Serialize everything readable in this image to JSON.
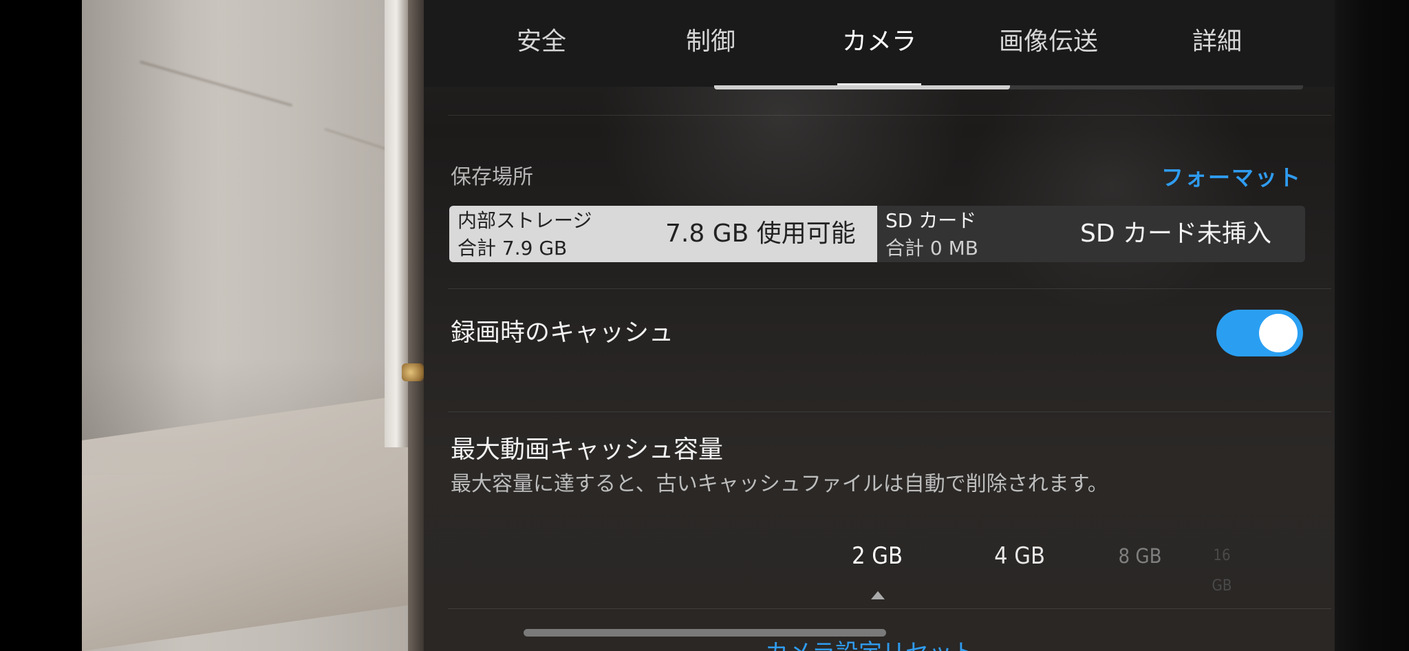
{
  "tabs": [
    {
      "label": "安全",
      "active": false
    },
    {
      "label": "制御",
      "active": false
    },
    {
      "label": "カメラ",
      "active": true
    },
    {
      "label": "画像伝送",
      "active": false
    },
    {
      "label": "詳細",
      "active": false
    }
  ],
  "storage": {
    "section_label": "保存場所",
    "format_label": "フォーマット",
    "internal": {
      "title": "内部ストレージ",
      "total": "合計 7.9 GB",
      "available": "7.8 GB 使用可能"
    },
    "sd": {
      "title": "SD カード",
      "total": "合計 0 MB",
      "status": "SD カード未挿入"
    }
  },
  "recording_cache": {
    "label": "録画時のキャッシュ",
    "enabled": true
  },
  "max_cache": {
    "label": "最大動画キャッシュ容量",
    "description": "最大容量に達すると、古いキャッシュファイルは自動で削除されます。",
    "options": [
      "2 GB",
      "4 GB",
      "8 GB",
      "16 GB"
    ],
    "selected": "2 GB"
  },
  "reset_label": "カメラ設定リセット",
  "colors": {
    "accent": "#2f9cf0",
    "toggle_on": "#2a9ff2"
  }
}
